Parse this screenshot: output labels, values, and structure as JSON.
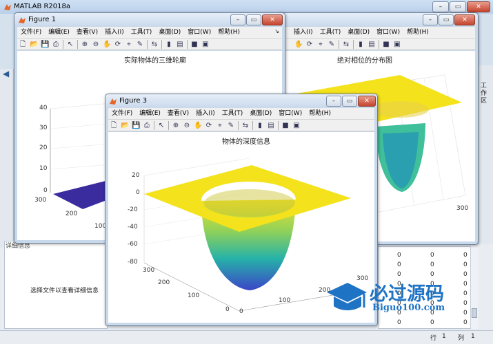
{
  "app": {
    "title": "MATLAB R2018a",
    "left_panel": {
      "header": "详细信息",
      "hint": "选择文件以查看详细信息"
    },
    "right_tab": "工作区",
    "status": {
      "row_label": "行",
      "row_value": "1",
      "col_label": "列",
      "col_value": "1"
    },
    "workspace_zeros": [
      "0",
      "0",
      "0",
      "0",
      "0",
      "0",
      "0",
      "0",
      "0",
      "0",
      "0",
      "0",
      "0",
      "0",
      "0",
      "0",
      "0",
      "0",
      "0",
      "0",
      "0",
      "0",
      "0",
      "0"
    ]
  },
  "menus": [
    "文件(F)",
    "编辑(E)",
    "查看(V)",
    "插入(I)",
    "工具(T)",
    "桌面(D)",
    "窗口(W)",
    "帮助(H)"
  ],
  "figure1": {
    "title": "Figure 1",
    "plot_title": "实际物体的三维轮廓",
    "z_ticks": [
      "40",
      "30",
      "20",
      "10",
      "0"
    ],
    "y_ticks": [
      "300",
      "200",
      "100"
    ]
  },
  "figure2": {
    "plot_title": "绝对相位的分布图",
    "x_tick": "300"
  },
  "figure3": {
    "title": "Figure 3",
    "plot_title": "物体的深度信息",
    "z_ticks": [
      "20",
      "0",
      "-20",
      "-40",
      "-60",
      "-80"
    ],
    "y_ticks": [
      "300",
      "200",
      "100",
      "0"
    ],
    "x_ticks": [
      "0",
      "100",
      "200",
      "300"
    ]
  },
  "watermark": {
    "name": "必过源码",
    "url": "Biguo100.com"
  },
  "colors": {
    "surface_yellow": "#f4e21c",
    "surface_blue": "#3a2c9e",
    "bowl_teal": "#2fb5a5"
  }
}
